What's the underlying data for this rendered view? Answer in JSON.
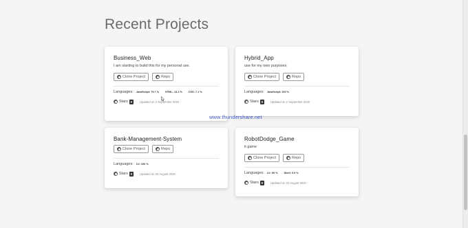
{
  "section": {
    "heading": "Recent Projects"
  },
  "watermark": "www.thundershare.net",
  "projects": [
    {
      "title": "Business_Web",
      "description": "I am starting to build this for my personal use.",
      "clone_label": "Clone Project",
      "repo_label": "Repo",
      "languages_label": "Languages:",
      "languages": [
        "JavaScript: 79.7 %",
        "HTML: 13.1 %",
        "CSS: 7.1 %"
      ],
      "stars_label": "Stars",
      "stars_count": "0",
      "updated": "Updated on 2 September 2020"
    },
    {
      "title": "Hybrid_App",
      "description": "use for my own purposes",
      "clone_label": "Clone Project",
      "repo_label": "Repo",
      "languages_label": "Languages:",
      "languages": [
        "JavaScript: 100 %"
      ],
      "stars_label": "Stars",
      "stars_count": "0",
      "updated": "Updated on 2 September 2020"
    },
    {
      "title": "Bank-Management-System",
      "description": "",
      "clone_label": "Clone Project",
      "repo_label": "Repo",
      "languages_label": "Languages:",
      "languages": [
        "C#: 100 %"
      ],
      "stars_label": "Stars",
      "stars_count": "0",
      "updated": "Updated on 30 August 2020"
    },
    {
      "title": "RobotDodge_Game",
      "description": "it game",
      "clone_label": "Clone Project",
      "repo_label": "Repo",
      "languages_label": "Languages:",
      "languages": [
        "C#: 99 %",
        "Shell: 0.9 %"
      ],
      "stars_label": "Stars",
      "stars_count": "0",
      "updated": "Updated on 23 August 2020"
    }
  ],
  "icons": {
    "clone": "github-icon",
    "repo": "github-icon",
    "stars": "github-icon"
  },
  "colors": {
    "watermark": "#3a54c9",
    "background": "#f5f5f5"
  }
}
